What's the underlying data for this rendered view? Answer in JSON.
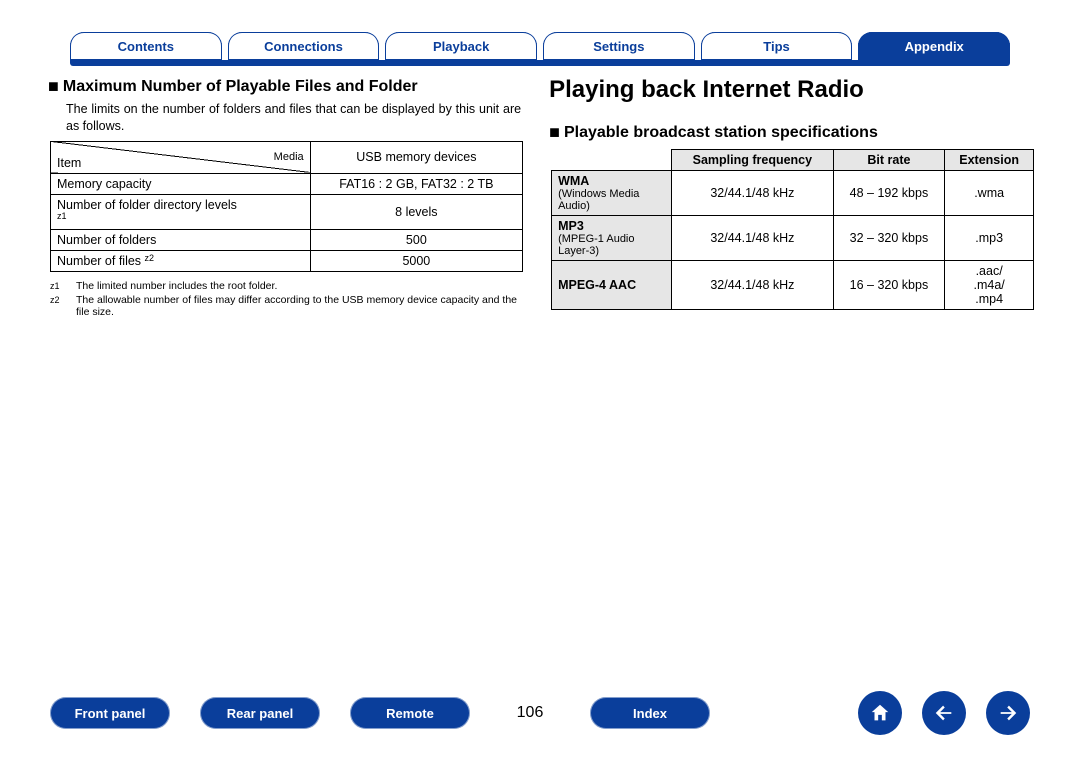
{
  "topnav": {
    "items": [
      {
        "label": "Contents"
      },
      {
        "label": "Connections"
      },
      {
        "label": "Playback"
      },
      {
        "label": "Settings"
      },
      {
        "label": "Tips"
      },
      {
        "label": "Appendix"
      }
    ]
  },
  "left": {
    "heading": "Maximum Number of Playable Files and Folder",
    "intro": "The limits on the number of folders and files that can be displayed by this unit are as follows.",
    "table": {
      "media_label": "Media",
      "item_label": "Item",
      "col2_header": "USB memory devices",
      "rows": [
        {
          "c0": "Memory capacity",
          "c1": "FAT16 : 2 GB, FAT32 : 2 TB"
        },
        {
          "c0": "Number of folder directory levels",
          "star": "1",
          "c1": "8 levels"
        },
        {
          "c0": "Number of folders",
          "c1": "500"
        },
        {
          "c0": "Number of files",
          "star": "2",
          "c1": "5000"
        }
      ]
    },
    "footnotes": [
      {
        "star": "z1",
        "text": "The limited number includes the root folder."
      },
      {
        "star": "z2",
        "text": "The allowable number of files may differ according to the USB memory device capacity and the file size."
      }
    ]
  },
  "right": {
    "h1": "Playing back Internet Radio",
    "heading": "Playable broadcast station specifications",
    "table": {
      "headers": [
        "",
        "Sampling frequency",
        "Bit rate",
        "Extension"
      ],
      "rows": [
        {
          "codec_main": "WMA",
          "codec_sub": "(Windows Media Audio)",
          "c1": "32/44.1/48 kHz",
          "c2": "48 – 192 kbps",
          "c3": ".wma"
        },
        {
          "codec_main": "MP3",
          "codec_sub": "(MPEG-1 Audio Layer-3)",
          "c1": "32/44.1/48 kHz",
          "c2": "32 – 320 kbps",
          "c3": ".mp3"
        },
        {
          "codec_main": "MPEG-4 AAC",
          "codec_sub": "",
          "c1": "32/44.1/48 kHz",
          "c2": "16 – 320 kbps",
          "c3": ".aac/\n.m4a/\n.mp4"
        }
      ]
    }
  },
  "bottomnav": {
    "pills": [
      {
        "label": "Front panel"
      },
      {
        "label": "Rear panel"
      },
      {
        "label": "Remote"
      }
    ],
    "page": "106",
    "index_pill": "Index"
  }
}
